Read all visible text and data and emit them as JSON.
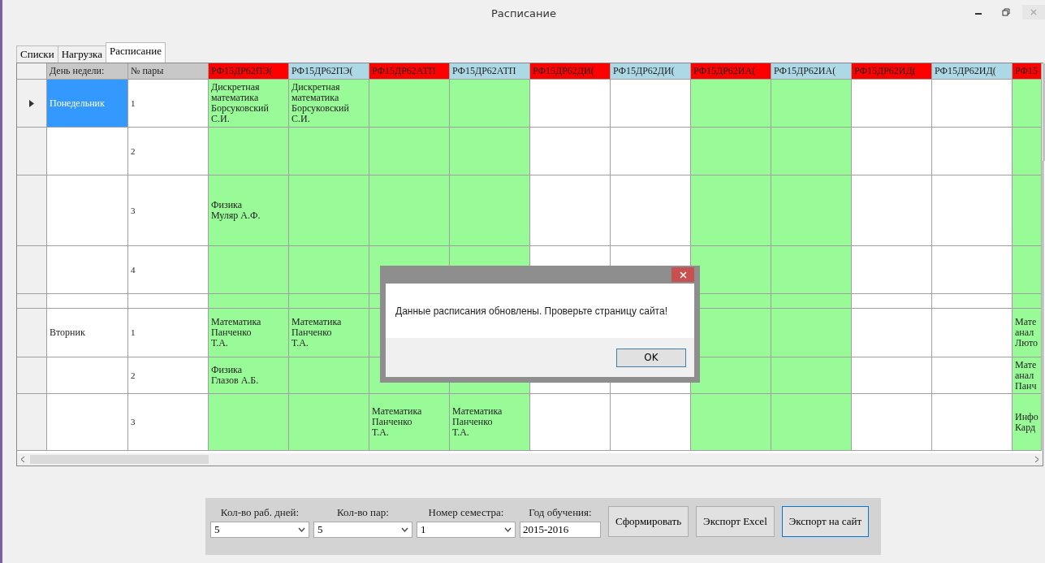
{
  "window": {
    "title": "Расписание"
  },
  "tabs": [
    {
      "label": "Списки",
      "selected": false
    },
    {
      "label": "Нагрузка",
      "selected": false
    },
    {
      "label": "Расписание",
      "selected": true
    }
  ],
  "table": {
    "columns": [
      {
        "label": "День недели:"
      },
      {
        "label": "№ пары"
      }
    ],
    "groups": [
      {
        "label": "РФ15ДР62ПЭ(",
        "color": "#ff0000"
      },
      {
        "label": "РФ15ДР62ПЭ(",
        "color": "#add8e6"
      },
      {
        "label": "РФ15ДР62АТП",
        "color": "#ff0000"
      },
      {
        "label": "РФ15ДР62АТП",
        "color": "#add8e6"
      },
      {
        "label": "РФ15ДР62ДИ(",
        "color": "#ff0000"
      },
      {
        "label": "РФ15ДР62ДИ(",
        "color": "#add8e6"
      },
      {
        "label": "РФ15ДР62ИА(",
        "color": "#ff0000"
      },
      {
        "label": "РФ15ДР62ИА(",
        "color": "#add8e6"
      },
      {
        "label": "РФ15ДР62ИД(",
        "color": "#ff0000"
      },
      {
        "label": "РФ15ДР62ИД(",
        "color": "#add8e6"
      },
      {
        "label": "РФ15",
        "color": "#ff0000"
      }
    ],
    "rows": [
      {
        "selected": true,
        "day": "Понедельник",
        "pair": "1",
        "cells": [
          {
            "text": "Дискретная\nматематика\nБорсуковский\nС.И.",
            "highlighted": true
          },
          {
            "text": "Дискретная\nматематика\nБорсуковский\nС.И.",
            "highlighted": true
          },
          {
            "highlighted": true
          },
          {
            "highlighted": true
          },
          {
            "highlighted": false
          },
          {
            "highlighted": false
          },
          {
            "highlighted": true
          },
          {
            "highlighted": true
          },
          {
            "highlighted": false
          },
          {
            "highlighted": false
          },
          {
            "highlighted": true
          }
        ]
      },
      {
        "selected": false,
        "pair": "2",
        "cells": [
          {
            "highlighted": true
          },
          {
            "highlighted": true
          },
          {
            "highlighted": true
          },
          {
            "highlighted": true
          },
          {
            "highlighted": false
          },
          {
            "highlighted": false
          },
          {
            "highlighted": true
          },
          {
            "highlighted": true
          },
          {
            "highlighted": false
          },
          {
            "highlighted": false
          },
          {
            "highlighted": true
          }
        ]
      },
      {
        "selected": false,
        "pair": "3",
        "cells": [
          {
            "text": "Физика\nМуляр  А.Ф.",
            "highlighted": true
          },
          {
            "highlighted": true
          },
          {
            "highlighted": true
          },
          {
            "highlighted": true
          },
          {
            "highlighted": false
          },
          {
            "highlighted": false
          },
          {
            "highlighted": true
          },
          {
            "highlighted": true
          },
          {
            "highlighted": false
          },
          {
            "highlighted": false
          },
          {
            "highlighted": true
          }
        ]
      },
      {
        "selected": false,
        "pair": "4",
        "cells": [
          {
            "highlighted": true
          },
          {
            "highlighted": true
          },
          {
            "highlighted": true
          },
          {
            "highlighted": true
          },
          {
            "highlighted": false
          },
          {
            "highlighted": false
          },
          {
            "highlighted": true
          },
          {
            "highlighted": true
          },
          {
            "highlighted": false
          },
          {
            "highlighted": false
          },
          {
            "highlighted": true
          }
        ]
      },
      {
        "selected": false,
        "cells": [
          {
            "highlighted": true
          },
          {
            "highlighted": true
          },
          {
            "highlighted": true
          },
          {},
          {},
          {},
          {
            "highlighted": true
          },
          {
            "highlighted": true
          },
          {
            "highlighted": false
          },
          {
            "highlighted": false
          },
          {
            "highlighted": true
          }
        ]
      },
      {
        "selected": false,
        "day": "Вторник",
        "pair": "1",
        "cells": [
          {
            "text": "Математика\nПанченко\nТ.А.",
            "highlighted": true
          },
          {
            "text": "Математика\nПанченко\nТ.А.",
            "highlighted": true
          },
          {
            "highlighted": true
          },
          {},
          {},
          {},
          {
            "highlighted": true
          },
          {
            "highlighted": true
          },
          {
            "highlighted": false
          },
          {
            "highlighted": false
          },
          {
            "text": "Мате\nанал\nЛюто",
            "highlighted": true
          }
        ]
      },
      {
        "selected": false,
        "pair": "2",
        "cells": [
          {
            "text": "Физика\nГлазов  А.Б.",
            "highlighted": true
          },
          {
            "highlighted": true
          },
          {
            "highlighted": true
          },
          {
            "highlighted": true
          },
          {
            "highlighted": false
          },
          {
            "highlighted": false
          },
          {
            "highlighted": true
          },
          {
            "highlighted": true
          },
          {
            "highlighted": false
          },
          {
            "highlighted": false
          },
          {
            "text": "Мате\nанал\nПанч",
            "highlighted": true
          }
        ]
      },
      {
        "selected": false,
        "pair": "3",
        "cells": [
          {
            "highlighted": true
          },
          {
            "highlighted": true
          },
          {
            "text": "Математика\nПанченко\nТ.А.",
            "highlighted": true
          },
          {
            "text": "Математика\nПанченко\nТ.А.",
            "highlighted": true
          },
          {
            "highlighted": false
          },
          {
            "highlighted": false
          },
          {
            "highlighted": true
          },
          {
            "highlighted": true
          },
          {
            "highlighted": false
          },
          {
            "highlighted": false
          },
          {
            "text": "Инфо\nКард",
            "highlighted": true
          }
        ]
      }
    ]
  },
  "controls": {
    "fields": [
      {
        "label": "Кол-во раб. дней:",
        "value": "5",
        "kind": "select"
      },
      {
        "label": "Кол-во пар:",
        "value": "5",
        "kind": "select"
      },
      {
        "label": "Номер семестра:",
        "value": "1",
        "kind": "select"
      },
      {
        "label": "Год обучения:",
        "value": "2015-2016",
        "kind": "text"
      }
    ],
    "buttons": [
      {
        "label": "Сформировать",
        "focused": false
      },
      {
        "label": "Экспорт Excel",
        "focused": false
      },
      {
        "label": "Экспорт на сайт",
        "focused": true
      }
    ]
  },
  "dialog": {
    "message": "Данные расписания обновлены. Проверьте страницу сайта!",
    "button": "OK"
  }
}
